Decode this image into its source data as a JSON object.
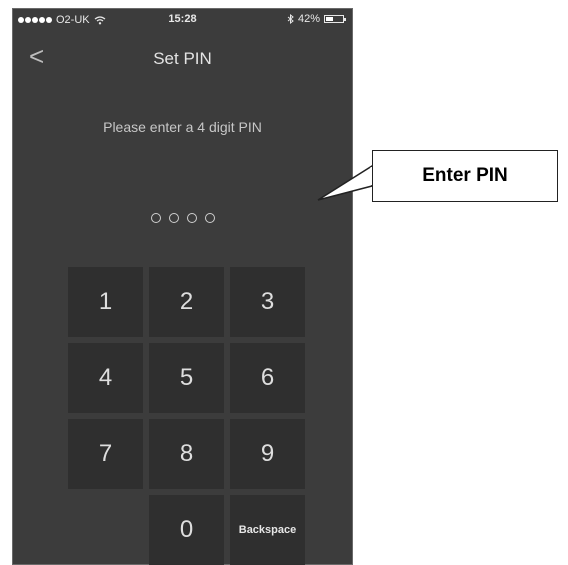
{
  "status_bar": {
    "carrier": "O2-UK",
    "time": "15:28",
    "battery": "42%",
    "battery_level": 0.42,
    "icons": [
      "signal-dots-icon",
      "wifi-icon",
      "bluetooth-icon",
      "battery-icon"
    ]
  },
  "nav": {
    "back_symbol": "<",
    "title": "Set PIN"
  },
  "instruction": "Please enter a 4 digit PIN",
  "pin_length": 4,
  "keypad": {
    "rows": [
      [
        "1",
        "2",
        "3"
      ],
      [
        "4",
        "5",
        "6"
      ],
      [
        "7",
        "8",
        "9"
      ],
      [
        "",
        "0",
        "Backspace"
      ]
    ]
  },
  "callout": {
    "text": "Enter PIN"
  },
  "colors": {
    "screen_bg": "#3c3c3c",
    "key_bg": "#2f2f2f",
    "text": "#d8d8d8"
  }
}
